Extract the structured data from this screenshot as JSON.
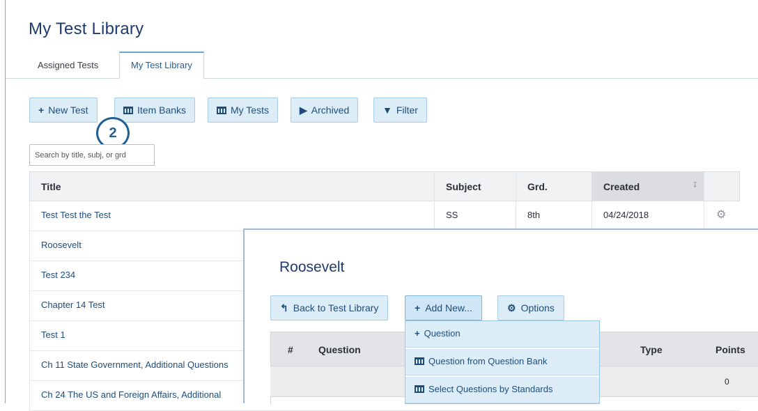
{
  "page": {
    "title": "My Test Library"
  },
  "tabs": [
    {
      "label": "Assigned Tests",
      "active": false
    },
    {
      "label": "My Test Library",
      "active": true
    }
  ],
  "toolbar": {
    "new_test": "New Test",
    "item_banks": "Item Banks",
    "my_tests": "My Tests",
    "archived": "Archived",
    "filter": "Filter"
  },
  "callout": {
    "number": "2"
  },
  "search": {
    "placeholder": "Search by title, subj, or grd"
  },
  "table": {
    "headers": {
      "title": "Title",
      "subject": "Subject",
      "grade": "Grd.",
      "created": "Created"
    },
    "rows": [
      {
        "title": "Test Test the Test",
        "subject": "SS",
        "grade": "8th",
        "created": "04/24/2018"
      },
      {
        "title": "Roosevelt"
      },
      {
        "title": "Test 234"
      },
      {
        "title": "Chapter 14 Test"
      },
      {
        "title": "Test 1"
      },
      {
        "title": "Ch 11 State Government, Additional Questions"
      },
      {
        "title": "Ch 24 The US and Foreign Affairs, Additional"
      }
    ]
  },
  "panel": {
    "title": "Roosevelt",
    "back_label": "Back to Test Library",
    "add_new_label": "Add New...",
    "options_label": "Options",
    "dropdown": [
      "Question",
      "Question from Question Bank",
      "Select Questions by Standards"
    ],
    "headers": {
      "num": "#",
      "question": "Question",
      "type": "Type",
      "points": "Points"
    },
    "first_row_points": "0"
  },
  "colors": {
    "accent": "#1f4d7a",
    "button_bg": "#dcedf8",
    "title": "#1f3b6f"
  }
}
